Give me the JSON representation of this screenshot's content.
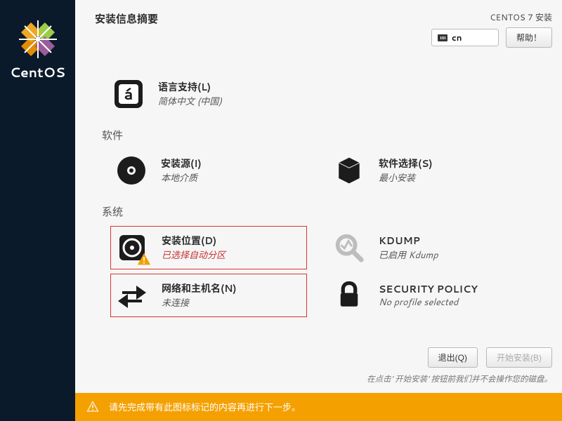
{
  "sidebar": {
    "product": "CentOS"
  },
  "header": {
    "title": "安装信息摘要",
    "product_line": "CENTOS 7 安装",
    "keyboard_layout": "cn",
    "help_label": "帮助！"
  },
  "sections": {
    "localization": {
      "language_support": {
        "title": "语言支持(L)",
        "status": "简体中文 (中国)"
      }
    },
    "software": {
      "header": "软件",
      "installation_source": {
        "title": "安装源(I)",
        "status": "本地介质"
      },
      "software_selection": {
        "title": "软件选择(S)",
        "status": "最小安装"
      }
    },
    "system": {
      "header": "系统",
      "installation_destination": {
        "title": "安装位置(D)",
        "status": "已选择自动分区"
      },
      "kdump": {
        "title": "KDUMP",
        "status": "已启用 Kdump"
      },
      "network": {
        "title": "网络和主机名(N)",
        "status": "未连接"
      },
      "security": {
        "title": "SECURITY POLICY",
        "status": "No profile selected"
      }
    }
  },
  "footer": {
    "quit": "退出(Q)",
    "begin": "开始安装(B)",
    "hint": "在点击' 开始安装' 按钮前我们并不会操作您的磁盘。"
  },
  "warning_bar": {
    "text": "请先完成带有此图标标记的内容再进行下一步。"
  }
}
